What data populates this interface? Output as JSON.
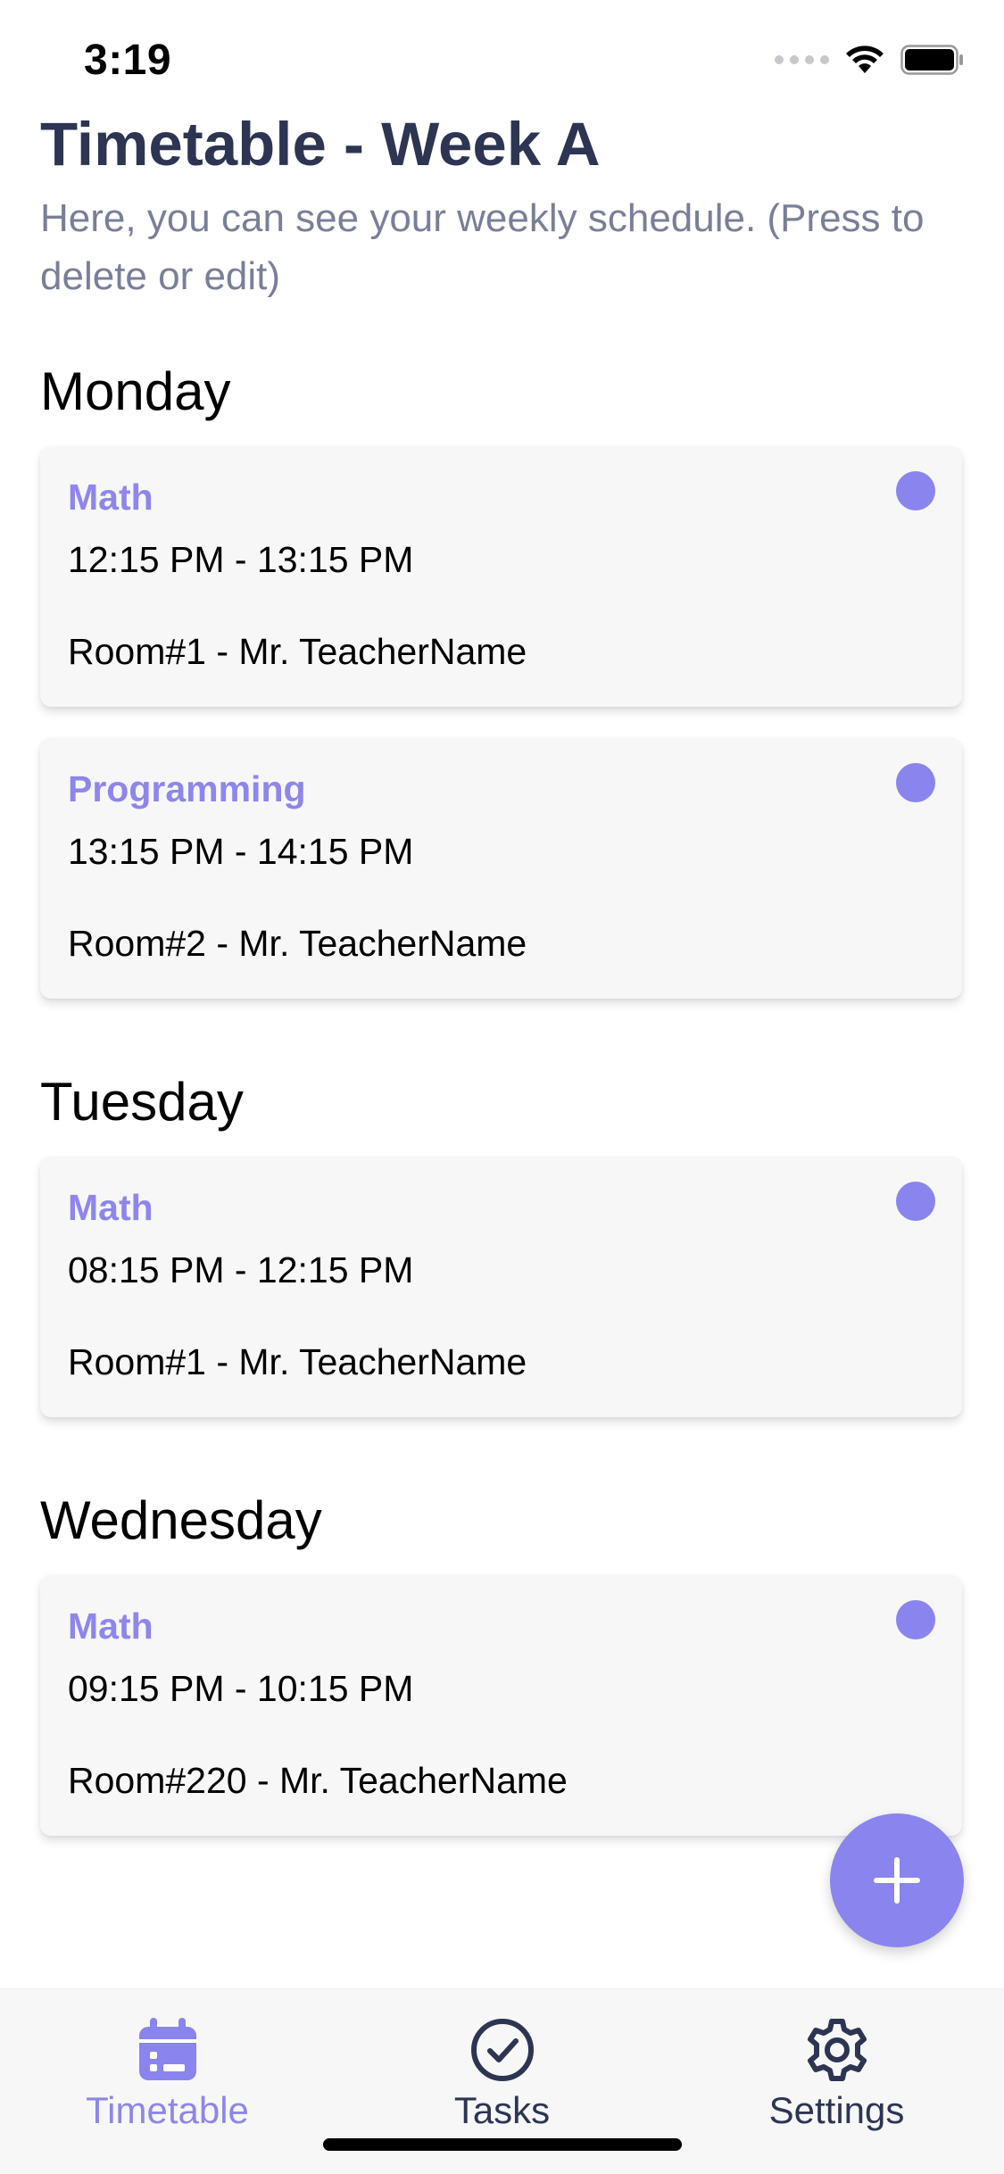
{
  "status_bar": {
    "time": "3:19",
    "icons": [
      "cellular-signal-icon",
      "wifi-icon",
      "battery-icon"
    ]
  },
  "header": {
    "title": "Timetable - Week A",
    "subtitle": "Here, you can see your weekly schedule. (Press to delete or edit)"
  },
  "days": [
    {
      "name": "Monday",
      "classes": [
        {
          "subject": "Math",
          "time": "12:15 PM - 13:15 PM",
          "room": "Room#1 - Mr. TeacherName"
        },
        {
          "subject": "Programming",
          "time": "13:15 PM - 14:15 PM",
          "room": "Room#2 - Mr. TeacherName"
        }
      ]
    },
    {
      "name": "Tuesday",
      "classes": [
        {
          "subject": "Math",
          "time": "08:15 PM - 12:15 PM",
          "room": "Room#1 - Mr. TeacherName"
        }
      ]
    },
    {
      "name": "Wednesday",
      "classes": [
        {
          "subject": "Math",
          "time": "09:15 PM - 10:15 PM",
          "room": "Room#220 - Mr. TeacherName"
        }
      ]
    }
  ],
  "fab": {
    "icon": "plus-icon"
  },
  "tab_bar": {
    "tabs": [
      {
        "label": "Timetable",
        "icon": "calendar-icon",
        "active": true
      },
      {
        "label": "Tasks",
        "icon": "check-circle-icon",
        "active": false
      },
      {
        "label": "Settings",
        "icon": "gear-icon",
        "active": false
      }
    ]
  },
  "colors": {
    "accent": "#8a84ef",
    "subject_text": "#8e86ec",
    "title_text": "#2d3553",
    "subtitle_text": "#7a7f98",
    "card_background": "#f7f7f7"
  }
}
